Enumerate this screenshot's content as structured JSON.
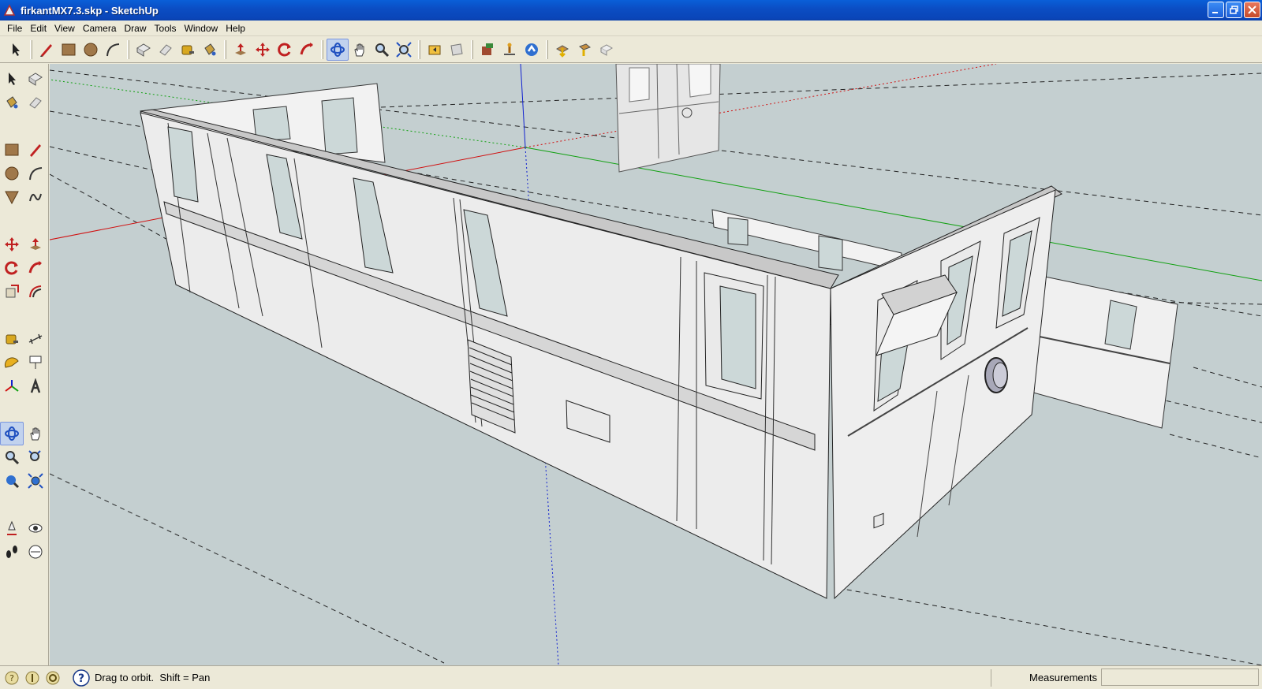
{
  "window": {
    "title": "firkantMX7.3.skp - SketchUp",
    "controls": [
      "minimize-icon",
      "maximize-icon",
      "close-icon"
    ]
  },
  "menu": {
    "items": [
      "File",
      "Edit",
      "View",
      "Camera",
      "Draw",
      "Tools",
      "Window",
      "Help"
    ]
  },
  "toolbar": {
    "groups": [
      [
        "select-icon",
        "pencil-icon",
        "rectangle-icon",
        "circle-icon",
        "arc-icon"
      ],
      [
        "make-component-icon",
        "eraser-icon",
        "tape-measure-icon",
        "paint-bucket-icon"
      ],
      [
        "push-pull-icon",
        "move-icon",
        "rotate-icon",
        "follow-me-icon"
      ],
      [
        "orbit-icon",
        "pan-icon",
        "zoom-icon",
        "zoom-extents-icon"
      ],
      [
        "previous-view-icon",
        "next-view-icon"
      ],
      [
        "add-location-icon",
        "toggle-terrain-icon",
        "get-models-icon"
      ],
      [
        "share-model-icon",
        "share-component-icon",
        "send-to-google-earth-icon"
      ]
    ],
    "active": "orbit-icon"
  },
  "palette": {
    "tools": [
      "select-icon",
      "make-component-icon",
      "paint-bucket-icon",
      "eraser-icon",
      "sep",
      "rectangle-icon",
      "pencil-icon",
      "circle-icon",
      "arc-icon",
      "polygon-icon",
      "freehand-icon",
      "sep",
      "move-icon",
      "push-pull-icon",
      "rotate-icon",
      "follow-me-icon",
      "scale-icon",
      "offset-icon",
      "sep",
      "tape-measure-icon",
      "dimension-icon",
      "protractor-icon",
      "text-icon",
      "axes-icon",
      "3d-text-icon",
      "sep",
      "orbit-icon",
      "pan-icon",
      "zoom-icon",
      "zoom-window-icon",
      "previous-view-icon",
      "zoom-extents-icon",
      "sep",
      "position-camera-icon",
      "look-around-icon",
      "walk-icon",
      "section-plane-icon"
    ],
    "active": "orbit-icon"
  },
  "status": {
    "icons": [
      "geo-location-icon",
      "credits-icon",
      "user-icon"
    ],
    "hint": "Drag to orbit.  Shift = Pan",
    "measurements_label": "Measurements",
    "measurements_value": ""
  },
  "colors": {
    "sky": "#c4cfd0",
    "chrome": "#ece9d8",
    "title_blue": "#0b4ec4",
    "axis_red": "#d01010",
    "axis_green": "#10a010",
    "axis_blue": "#1020d0"
  }
}
